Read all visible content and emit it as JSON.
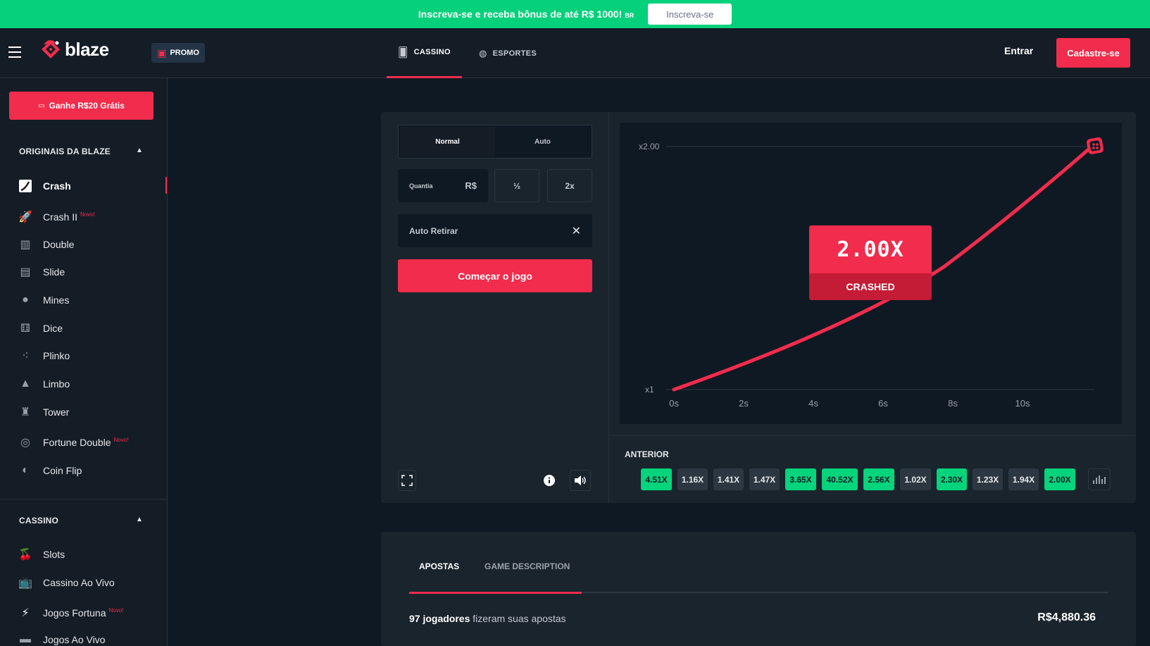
{
  "banner": {
    "text": "Inscreva-se e receba bônus de até R$ 1000!",
    "badge": "BR",
    "button": "Inscreva-se"
  },
  "header": {
    "logo": "blaze",
    "promo": "PROMO",
    "tabs": [
      {
        "label": "CASSINO"
      },
      {
        "label": "ESPORTES"
      }
    ],
    "login": "Entrar",
    "signup": "Cadastre-se"
  },
  "sidebar": {
    "bonus_button": "Ganhe R$20 Grátis",
    "originals_title": "ORIGINAIS DA BLAZE",
    "originals": [
      {
        "label": "Crash",
        "badge": "",
        "icon": "crash-icon"
      },
      {
        "label": "Crash II",
        "badge": "Novo!",
        "icon": "rocket-icon"
      },
      {
        "label": "Double",
        "badge": "",
        "icon": "double-icon"
      },
      {
        "label": "Slide",
        "badge": "",
        "icon": "slide-icon"
      },
      {
        "label": "Mines",
        "badge": "",
        "icon": "mine-icon"
      },
      {
        "label": "Dice",
        "badge": "",
        "icon": "dice-icon"
      },
      {
        "label": "Plinko",
        "badge": "",
        "icon": "plinko-icon"
      },
      {
        "label": "Limbo",
        "badge": "",
        "icon": "limbo-icon"
      },
      {
        "label": "Tower",
        "badge": "",
        "icon": "tower-icon"
      },
      {
        "label": "Fortune Double",
        "badge": "Novo!",
        "icon": "fortune-icon"
      },
      {
        "label": "Coin Flip",
        "badge": "",
        "icon": "coin-icon"
      }
    ],
    "casino_title": "CASSINO",
    "casino": [
      {
        "label": "Slots",
        "badge": "",
        "icon": "cherry-icon"
      },
      {
        "label": "Cassino Ao Vivo",
        "badge": "",
        "icon": "tv-icon"
      },
      {
        "label": "Jogos Fortuna",
        "badge": "Novo!",
        "icon": "lightning-icon"
      },
      {
        "label": "Jogos Ao Vivo",
        "badge": "",
        "icon": "live-icon"
      }
    ]
  },
  "game": {
    "modes": [
      "Normal",
      "Auto"
    ],
    "amount_label": "Quantia",
    "currency": "R$",
    "half_btn": "½",
    "double_btn": "2x",
    "auto_cashout": "Auto Retirar",
    "start_button": "Começar o jogo",
    "multiplier": "2.00X",
    "status": "CRASHED",
    "chart": {
      "y_top_label": "x2.00",
      "y_bottom_label": "x1",
      "x_labels": [
        "0s",
        "2s",
        "4s",
        "6s",
        "8s",
        "10s"
      ]
    },
    "history_title": "ANTERIOR",
    "history": [
      {
        "value": "4.51X",
        "win": true
      },
      {
        "value": "1.16X",
        "win": false
      },
      {
        "value": "1.41X",
        "win": false
      },
      {
        "value": "1.47X",
        "win": false
      },
      {
        "value": "3.65X",
        "win": true
      },
      {
        "value": "40.52X",
        "win": true
      },
      {
        "value": "2.56X",
        "win": true
      },
      {
        "value": "1.02X",
        "win": false
      },
      {
        "value": "2.30X",
        "win": true
      },
      {
        "value": "1.23X",
        "win": false
      },
      {
        "value": "1.94X",
        "win": false
      },
      {
        "value": "2.00X",
        "win": true
      }
    ]
  },
  "bets": {
    "tabs": [
      "APOSTAS",
      "GAME DESCRIPTION"
    ],
    "players_count": "97 jogadores",
    "players_suffix": "fizeram suas apostas",
    "total": "R$4,880.36"
  },
  "colors": {
    "accent": "#f12c4c",
    "green": "#04d47c",
    "bg": "#0f1923",
    "panel": "#1a242d"
  }
}
